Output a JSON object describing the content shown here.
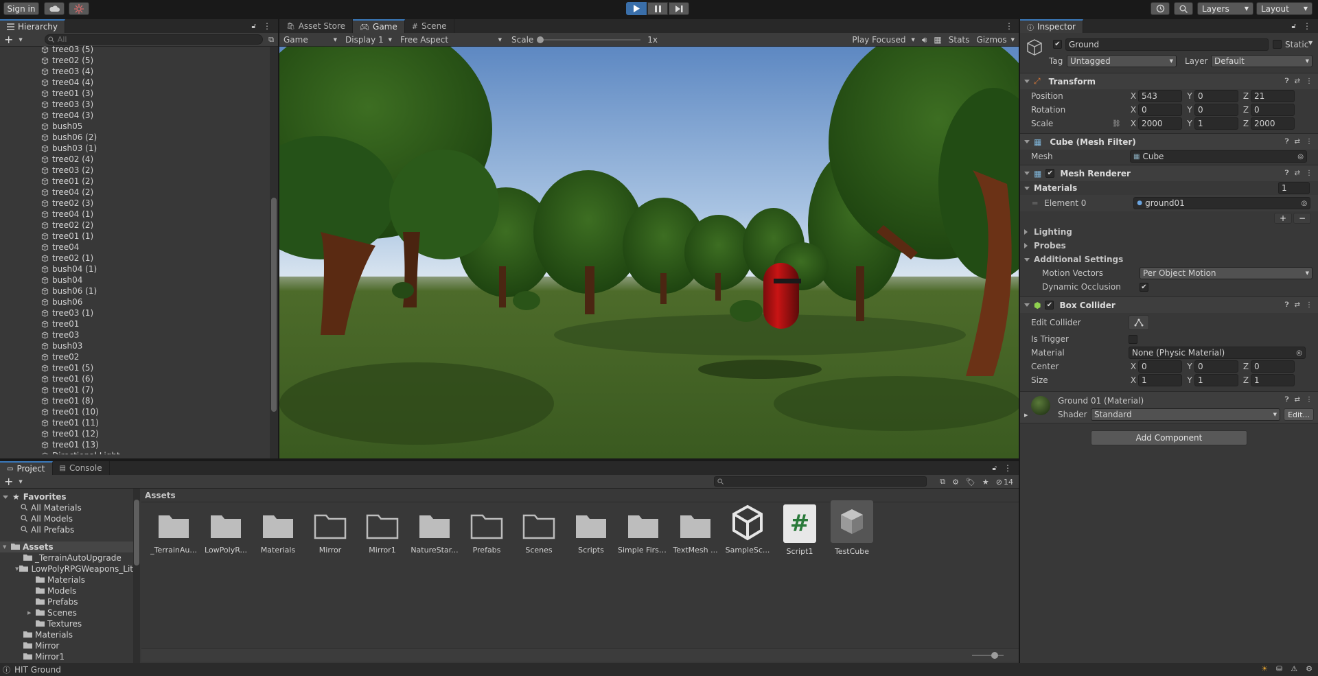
{
  "toolbar": {
    "sign_in": "Sign in",
    "layers": "Layers",
    "layout": "Layout"
  },
  "hierarchy": {
    "tab": "Hierarchy",
    "search_placeholder": "All",
    "items": [
      "tree03 (5)",
      "tree02 (5)",
      "tree03 (4)",
      "tree04 (4)",
      "tree01 (3)",
      "tree03 (3)",
      "tree04 (3)",
      "bush05",
      "bush06 (2)",
      "bush03 (1)",
      "tree02 (4)",
      "tree03 (2)",
      "tree01 (2)",
      "tree04 (2)",
      "tree02 (3)",
      "tree04 (1)",
      "tree02 (2)",
      "tree01 (1)",
      "tree04",
      "tree02 (1)",
      "bush04 (1)",
      "bush04",
      "bush06 (1)",
      "bush06",
      "tree03 (1)",
      "tree01",
      "tree03",
      "bush03",
      "tree02",
      "tree01 (5)",
      "tree01 (6)",
      "tree01 (7)",
      "tree01 (8)",
      "tree01 (10)",
      "tree01 (11)",
      "tree01 (12)",
      "tree01 (13)",
      "Directional Light"
    ]
  },
  "game_view": {
    "tabs": [
      "Asset Store",
      "Game",
      "Scene"
    ],
    "view_mode": "Game",
    "display": "Display 1",
    "aspect": "Free Aspect",
    "scale_label": "Scale",
    "scale_value": "1x",
    "play_focused": "Play Focused",
    "stats": "Stats",
    "gizmos": "Gizmos"
  },
  "inspector": {
    "tab": "Inspector",
    "object_name": "Ground",
    "static_label": "Static",
    "tag_label": "Tag",
    "tag_value": "Untagged",
    "layer_label": "Layer",
    "layer_value": "Default",
    "transform": {
      "title": "Transform",
      "position_label": "Position",
      "rotation_label": "Rotation",
      "scale_label": "Scale",
      "position": [
        "543",
        "0",
        "21"
      ],
      "rotation": [
        "0",
        "0",
        "0"
      ],
      "scale": [
        "2000",
        "1",
        "2000"
      ]
    },
    "mesh_filter": {
      "title": "Cube (Mesh Filter)",
      "mesh_label": "Mesh",
      "mesh_value": "Cube"
    },
    "mesh_renderer": {
      "title": "Mesh Renderer",
      "materials_label": "Materials",
      "materials_count": "1",
      "element_label": "Element 0",
      "element_value": "ground01",
      "lighting": "Lighting",
      "probes": "Probes",
      "additional": "Additional Settings",
      "motion_vectors_label": "Motion Vectors",
      "motion_vectors_value": "Per Object Motion",
      "dynamic_occlusion_label": "Dynamic Occlusion"
    },
    "box_collider": {
      "title": "Box Collider",
      "edit_collider": "Edit Collider",
      "is_trigger": "Is Trigger",
      "material_label": "Material",
      "material_value": "None (Physic Material)",
      "center_label": "Center",
      "size_label": "Size",
      "center": [
        "0",
        "0",
        "0"
      ],
      "size": [
        "1",
        "1",
        "1"
      ]
    },
    "material": {
      "title": "Ground 01 (Material)",
      "shader_label": "Shader",
      "shader_value": "Standard",
      "edit": "Edit..."
    },
    "add_component": "Add Component"
  },
  "project": {
    "tabs": [
      "Project",
      "Console"
    ],
    "hidden_count": "14",
    "breadcrumb": "Assets",
    "favorites_label": "Favorites",
    "favorites": [
      "All Materials",
      "All Models",
      "All Prefabs"
    ],
    "tree": [
      {
        "label": "Assets",
        "indent": 0
      },
      {
        "label": "_TerrainAutoUpgrade",
        "indent": 1
      },
      {
        "label": "LowPolyRPGWeapons_Lit",
        "indent": 1
      },
      {
        "label": "Materials",
        "indent": 2
      },
      {
        "label": "Models",
        "indent": 2
      },
      {
        "label": "Prefabs",
        "indent": 2
      },
      {
        "label": "Scenes",
        "indent": 2
      },
      {
        "label": "Textures",
        "indent": 2
      },
      {
        "label": "Materials",
        "indent": 1
      },
      {
        "label": "Mirror",
        "indent": 1
      },
      {
        "label": "Mirror1",
        "indent": 1
      }
    ],
    "assets": [
      "_TerrainAu...",
      "LowPolyR...",
      "Materials",
      "Mirror",
      "Mirror1",
      "NatureStar...",
      "Prefabs",
      "Scenes",
      "Scripts",
      "Simple First...",
      "TextMesh ...",
      "SampleSc...",
      "Script1",
      "TestCube"
    ]
  },
  "status_bar": {
    "message": "HIT Ground"
  },
  "colors": {
    "accent": "#3a79bb",
    "panel": "#383838",
    "header": "#282828"
  }
}
